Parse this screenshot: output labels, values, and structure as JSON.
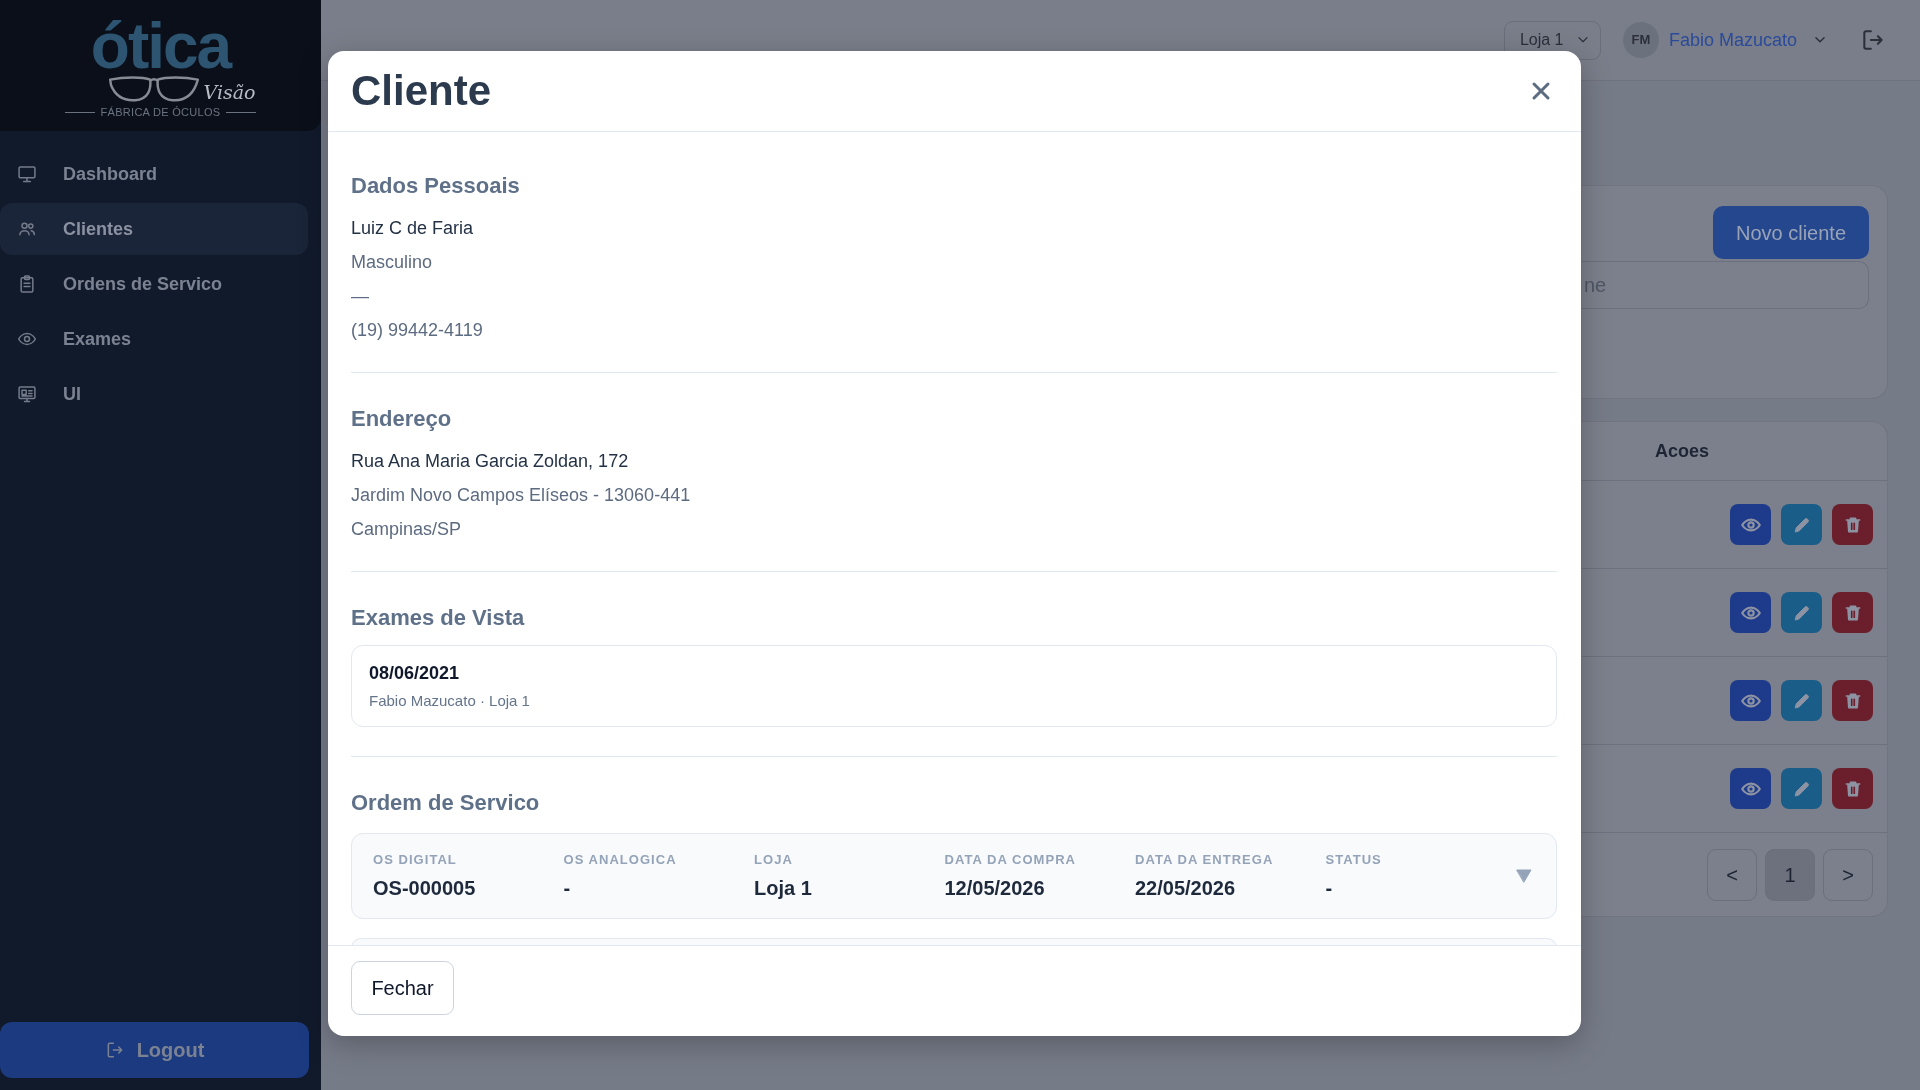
{
  "sidebar": {
    "logo": {
      "wordmark": "ótica",
      "script": "Visão",
      "tagline": "FÁBRICA DE ÓCULOS"
    },
    "items": [
      {
        "label": "Dashboard",
        "selected": false
      },
      {
        "label": "Clientes",
        "selected": true
      },
      {
        "label": "Ordens de Servico",
        "selected": false
      },
      {
        "label": "Exames",
        "selected": false
      },
      {
        "label": "UI",
        "selected": false
      }
    ],
    "logout": "Logout"
  },
  "header": {
    "store_select": "Loja 1",
    "user": {
      "initials": "FM",
      "name": "Fabio Mazucato"
    }
  },
  "clients_panel": {
    "new_button": "Novo cliente",
    "search": {
      "placeholder": "ne"
    }
  },
  "clients_table": {
    "columns": [
      "Acoes"
    ],
    "rows": [
      {
        "actions": [
          {
            "kind": "view"
          },
          {
            "kind": "edit"
          },
          {
            "kind": "delete"
          }
        ]
      },
      {
        "actions": [
          {
            "kind": "view"
          },
          {
            "kind": "edit"
          },
          {
            "kind": "delete"
          }
        ]
      },
      {
        "actions": [
          {
            "kind": "view"
          },
          {
            "kind": "edit"
          },
          {
            "kind": "delete"
          }
        ]
      },
      {
        "actions": [
          {
            "kind": "view"
          },
          {
            "kind": "edit"
          },
          {
            "kind": "delete"
          }
        ]
      }
    ],
    "pagination": [
      {
        "label": "<",
        "selected": false
      },
      {
        "label": "1",
        "selected": true
      },
      {
        "label": ">",
        "selected": false
      }
    ]
  },
  "modal": {
    "title": "Cliente",
    "sections": [
      {
        "kind": "lines",
        "title": "Dados Pessoais",
        "lines": [
          {
            "text": "Luiz C de Faria",
            "strong": true
          },
          {
            "text": "Masculino",
            "strong": false
          },
          {
            "text": "—",
            "strong": false
          },
          {
            "text": "(19) 99442-4119",
            "strong": false
          }
        ]
      },
      {
        "kind": "lines",
        "title": "Endereço",
        "lines": [
          {
            "text": "Rua Ana Maria Garcia Zoldan, 172",
            "strong": true
          },
          {
            "text": "Jardim Novo Campos Elíseos - 13060-441",
            "strong": false
          },
          {
            "text": "Campinas/SP",
            "strong": false
          }
        ]
      },
      {
        "kind": "exams",
        "title": "Exames de Vista",
        "items": [
          {
            "date": "08/06/2021",
            "meta": "Fabio Mazucato · Loja 1"
          }
        ]
      },
      {
        "kind": "orders",
        "title": "Ordem de Servico",
        "items": [
          {
            "fields": [
              {
                "label": "OS DIGITAL",
                "value": "OS-000005"
              },
              {
                "label": "OS ANALOGICA",
                "value": "-"
              },
              {
                "label": "LOJA",
                "value": "Loja 1"
              },
              {
                "label": "DATA DA COMPRA",
                "value": "12/05/2026"
              },
              {
                "label": "DATA DA ENTREGA",
                "value": "22/05/2026"
              },
              {
                "label": "STATUS",
                "value": "-"
              }
            ],
            "expanded": false
          }
        ]
      }
    ],
    "close_button": "Fechar"
  }
}
